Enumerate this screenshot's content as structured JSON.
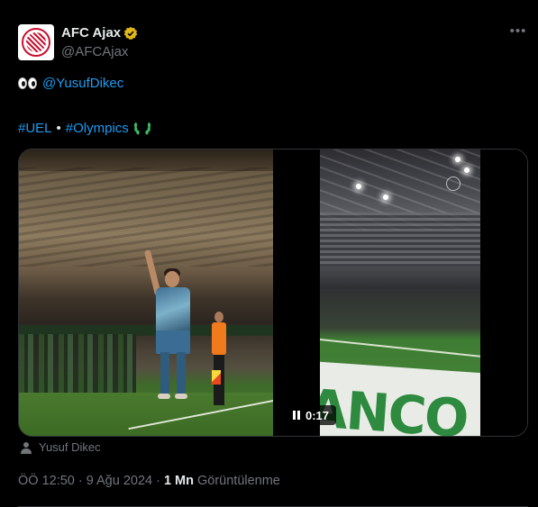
{
  "author": {
    "display_name": "AFC Ajax",
    "handle": "@AFCAjax",
    "verified": true,
    "badge_color": "#e2b719"
  },
  "more_icon": "more-horizontal-icon",
  "text": {
    "line1_mention": "@YusufDikec",
    "hashtag_uel": "#UEL",
    "separator": "•",
    "hashtag_olympics": "#Olympics"
  },
  "media": {
    "video_time": "0:17",
    "video_state": "playing",
    "banner_text": "ANCO"
  },
  "tagged": {
    "name": "Yusuf Dikec"
  },
  "meta": {
    "time": "ÖÖ 12:50",
    "dot1": "·",
    "date": "9 Ağu 2024",
    "dot2": "·",
    "views_count": "1 Mn",
    "views_label": "Görüntülenme"
  },
  "colors": {
    "link": "#1d9bf0",
    "muted": "#71767b",
    "text": "#e7e9ea",
    "background": "#000000"
  }
}
